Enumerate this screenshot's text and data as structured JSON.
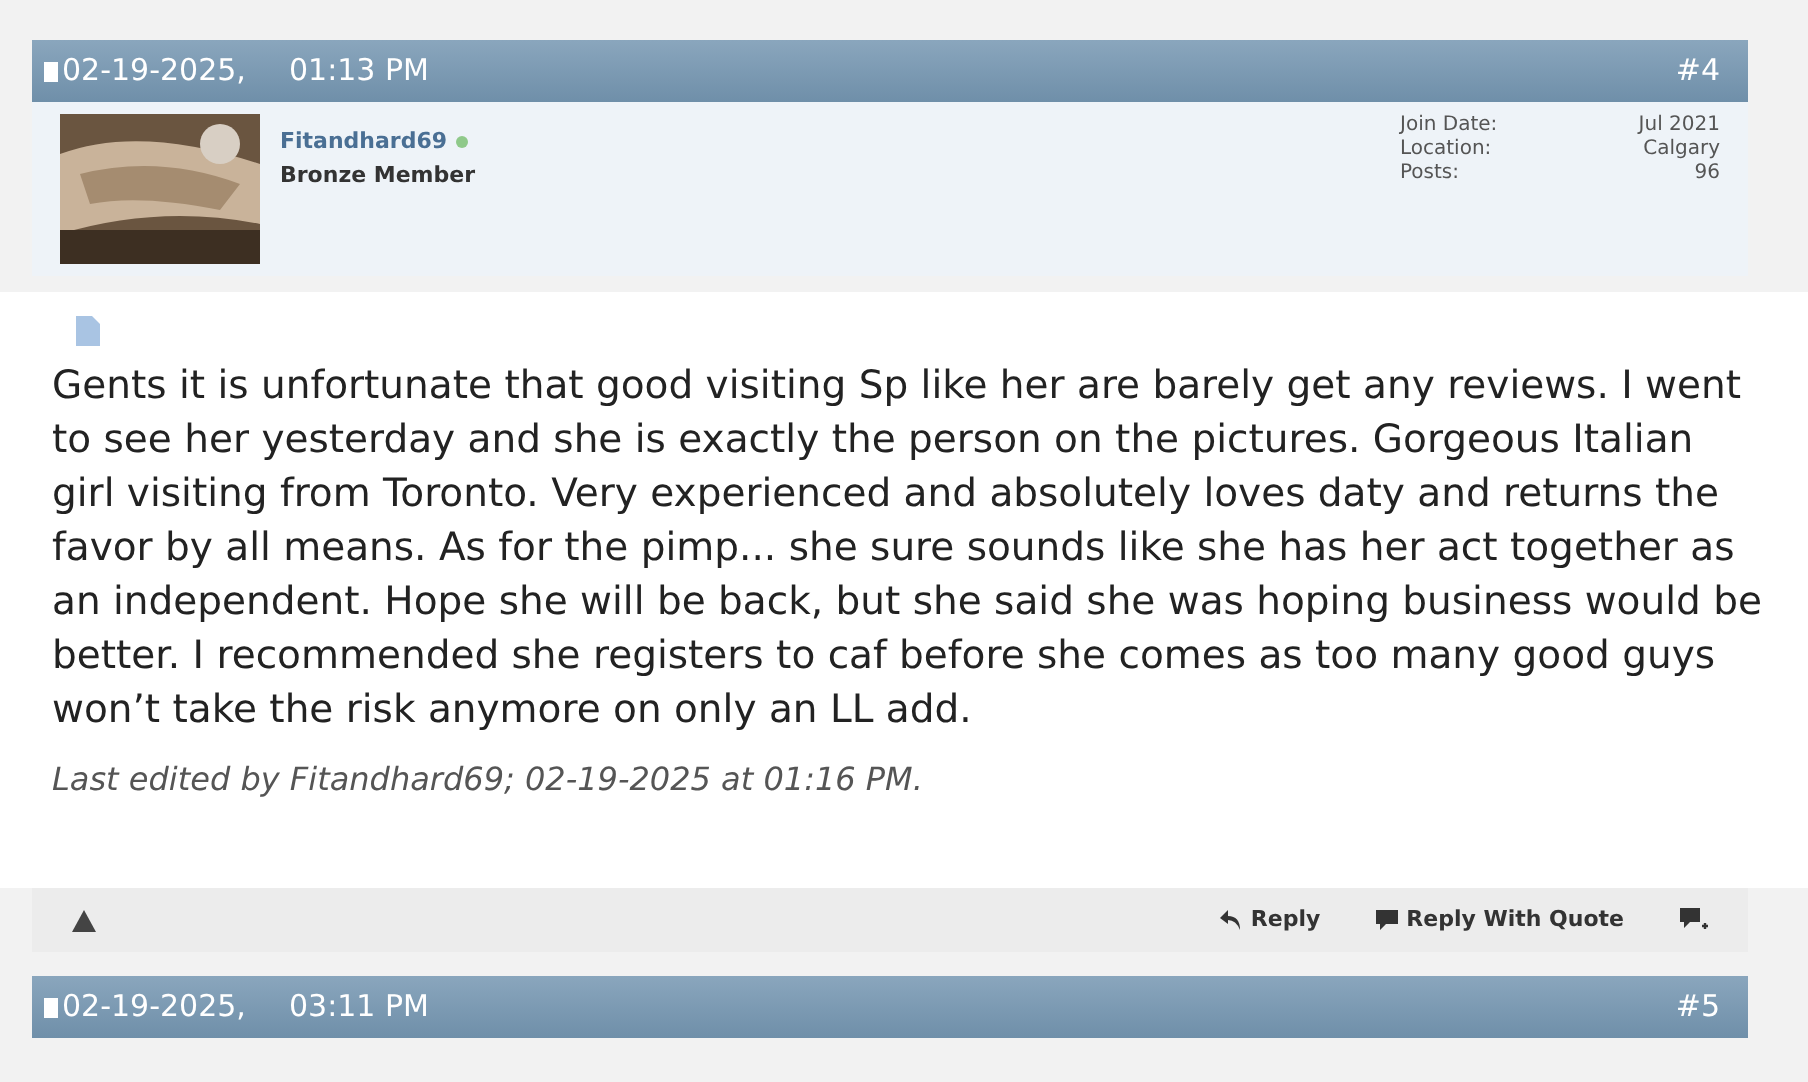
{
  "posts": [
    {
      "date": "02-19-2025,",
      "time": "01:13 PM",
      "number": "#4",
      "user": {
        "name": "Fitandhard69",
        "online": true,
        "rank": "Bronze Member"
      },
      "stats": [
        {
          "label": "Join Date:",
          "value": "Jul 2021"
        },
        {
          "label": "Location:",
          "value": "Calgary"
        },
        {
          "label": "Posts:",
          "value": "96"
        }
      ],
      "message": "Gents it is unfortunate that good visiting Sp like her are barely get any reviews. I went to see her yesterday and she is exactly the person on the pictures. Gorgeous Italian girl visiting from Toronto. Very experienced and absolutely loves daty and returns the favor by all means. As for the pimp... she sure sounds like she has her act together as an independent. Hope she will be back, but she said she was hoping business would be better. I recommended she registers to caf before she comes as too many good guys won’t take the risk anymore on only an LL add.",
      "edited": "Last edited by Fitandhard69; 02-19-2025 at 01:16 PM.",
      "actions": [
        "Reply",
        "Reply With Quote"
      ]
    },
    {
      "date": "02-19-2025,",
      "time": "03:11 PM",
      "number": "#5"
    }
  ]
}
